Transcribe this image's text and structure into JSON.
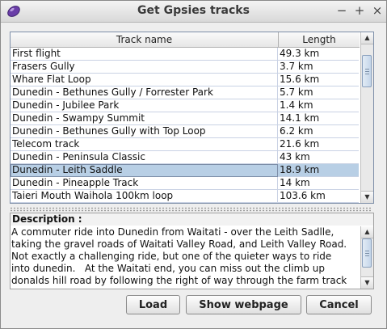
{
  "window": {
    "title": "Get Gpsies tracks"
  },
  "controls": {
    "minimize": "−",
    "maximize": "+",
    "close": "×"
  },
  "table": {
    "columns": [
      "Track name",
      "Length"
    ],
    "rows": [
      {
        "name": "First flight",
        "length": "49.3 km"
      },
      {
        "name": "Frasers Gully",
        "length": "3.7 km"
      },
      {
        "name": "Whare Flat Loop",
        "length": "15.6 km"
      },
      {
        "name": "Dunedin - Bethunes Gully / Forrester Park",
        "length": "5.7 km"
      },
      {
        "name": "Dunedin - Jubilee Park",
        "length": "1.4 km"
      },
      {
        "name": "Dunedin - Swampy Summit",
        "length": "14.1 km"
      },
      {
        "name": "Dunedin - Bethunes Gully with Top Loop",
        "length": "6.2 km"
      },
      {
        "name": "Telecom track",
        "length": "21.6 km"
      },
      {
        "name": "Dunedin - Peninsula Classic",
        "length": "43 km"
      },
      {
        "name": "Dunedin - Leith Saddle",
        "length": "18.9 km"
      },
      {
        "name": "Dunedin - Pineapple Track",
        "length": "14 km"
      },
      {
        "name": "Taieri Mouth Waihola 100km loop",
        "length": "103.6 km"
      }
    ],
    "selected_index": 9
  },
  "description": {
    "label": "Description :",
    "text": "A commuter ride into Dunedin from Waitati - over the Leith Sadlle,\ntaking the gravel roads of Waitati Valley Road, and Leith Valley Road.\nNot exactly a challenging ride, but one of the quieter ways to ride\ninto dunedin.   At the Waitati end, you can miss out the climb up\ndonalds hill road by following the right of way through the farm track"
  },
  "buttons": {
    "load": "Load",
    "show_webpage": "Show webpage",
    "cancel": "Cancel"
  },
  "icons": {
    "app": "app-icon",
    "up": "scroll-up-arrow-icon",
    "down": "scroll-down-arrow-icon"
  },
  "colors": {
    "selection": "#b8cfe5",
    "app_icon": "#6a3ea8"
  }
}
